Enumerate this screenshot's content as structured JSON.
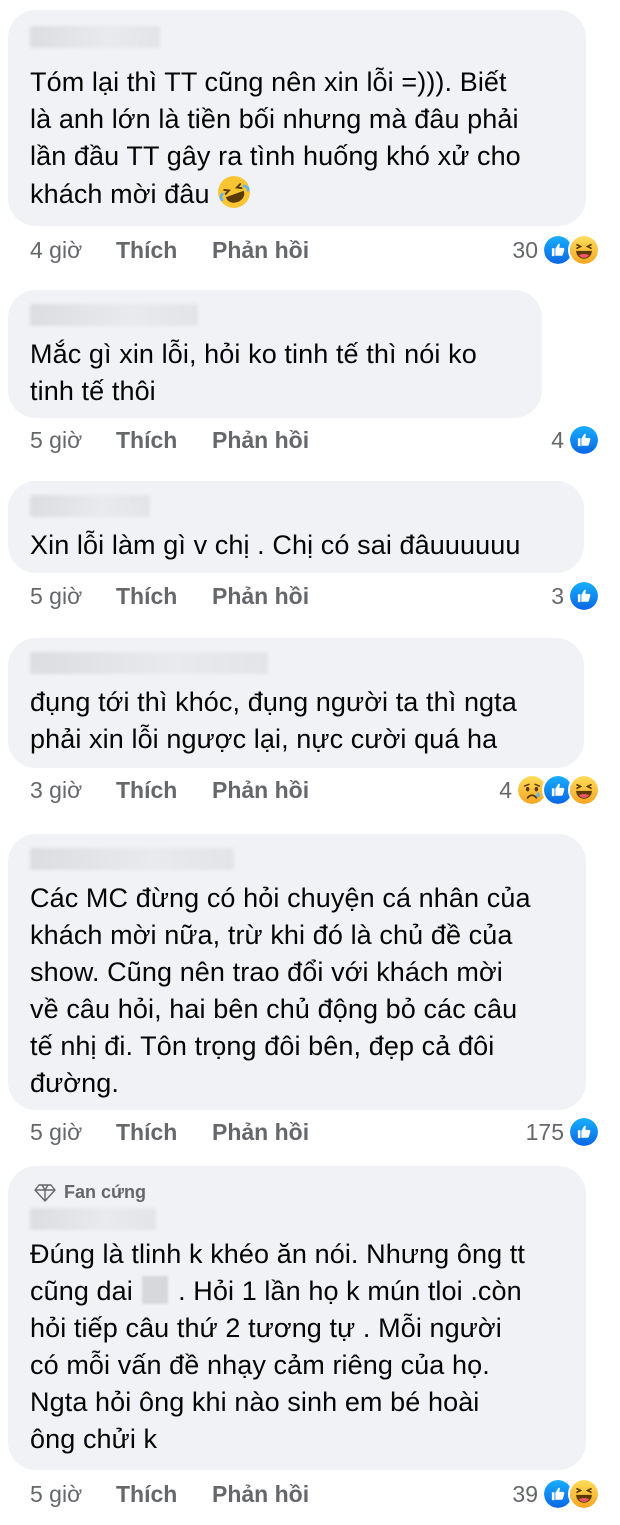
{
  "labels": {
    "like": "Thích",
    "reply": "Phản hồi"
  },
  "comments": [
    {
      "text": "Tóm lại thì TT cũng nên xin lỗi =))). Biết\nlà anh lớn là tiền bối nhưng mà đâu phải\nlần đầu TT gây ra tình huống khó xử cho\nkhách mời đâu",
      "emoji": "rolling-on-floor-laughing-emoji",
      "time": "4 giờ",
      "reaction_count": "30",
      "reactions": [
        "like",
        "haha"
      ]
    },
    {
      "text": "Mắc gì xin lỗi, hỏi ko tinh tế thì nói ko\ntinh tế thôi",
      "time": "5 giờ",
      "reaction_count": "4",
      "reactions": [
        "like"
      ]
    },
    {
      "text": "Xin lỗi làm gì v chị . Chị có sai đâuuuuuu",
      "time": "5 giờ",
      "reaction_count": "3",
      "reactions": [
        "like"
      ]
    },
    {
      "text": "đụng tới thì khóc, đụng người ta thì ngta\nphải xin lỗi ngược lại, nực cười quá ha",
      "time": "3 giờ",
      "reaction_count": "4",
      "reactions": [
        "sad",
        "like",
        "haha"
      ]
    },
    {
      "text": "Các MC đừng có hỏi chuyện cá nhân của\nkhách mời nữa, trừ khi đó là chủ đề của\nshow. Cũng nên trao đổi với khách mời\nvề câu hỏi, hai bên chủ động bỏ các câu\ntế nhị đi. Tôn trọng đôi bên, đẹp cả đôi\nđường.",
      "time": "5 giờ",
      "reaction_count": "175",
      "reactions": [
        "like"
      ]
    },
    {
      "badge": "Fan cứng",
      "text_before_censor": "Đúng là tlinh k khéo ăn nói. Nhưng ông tt\ncũng dai ",
      "text_after_censor": " . Hỏi 1 lần họ k mún tloi .còn\nhỏi tiếp câu thứ 2 tương tự . Mỗi người\ncó mỗi vấn đề nhạy cảm riêng của họ.\nNgta hỏi ông khi nào sinh em bé hoài\nông chửi k",
      "time": "5 giờ",
      "reaction_count": "39",
      "reactions": [
        "like",
        "haha"
      ]
    }
  ],
  "colors": {
    "bubble_bg": "#f0f2f5",
    "meta_text": "#65676b",
    "like_blue": "#1877f2",
    "haha_yellow": "#f7b928"
  }
}
